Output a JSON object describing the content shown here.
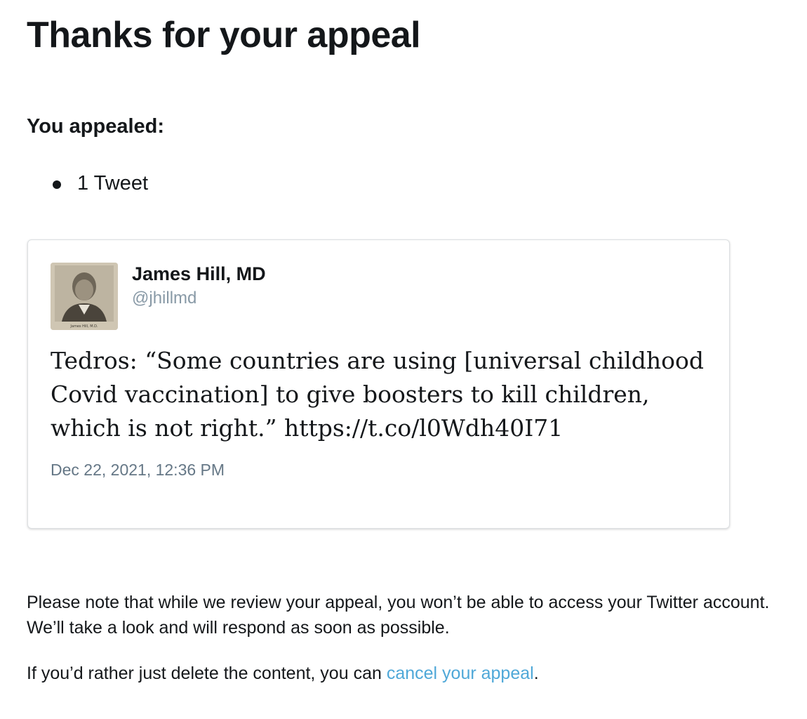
{
  "page": {
    "title": "Thanks for your appeal",
    "appealed_label": "You appealed:",
    "appealed_items": [
      "1 Tweet"
    ]
  },
  "tweet": {
    "author_name": "James Hill, MD",
    "author_handle": "@jhillmd",
    "text": "Tedros: “Some countries are using [universal childhood Covid vaccination] to give boosters to kill children, which is not right.” https://t.co/l0Wdh40I71",
    "timestamp": "Dec 22, 2021, 12:36 PM",
    "avatar_caption": "James Hill, M.D."
  },
  "notice": {
    "review_note": "Please note that while we review your appeal, you won’t be able to access your Twitter account. We’ll take a look and will respond as soon as possible.",
    "cancel_prefix": "If you’d rather just delete the content, you can ",
    "cancel_link": "cancel your appeal",
    "cancel_suffix": "."
  },
  "colors": {
    "text": "#14171a",
    "muted": "#8899a6",
    "link": "#4fa8d8"
  }
}
